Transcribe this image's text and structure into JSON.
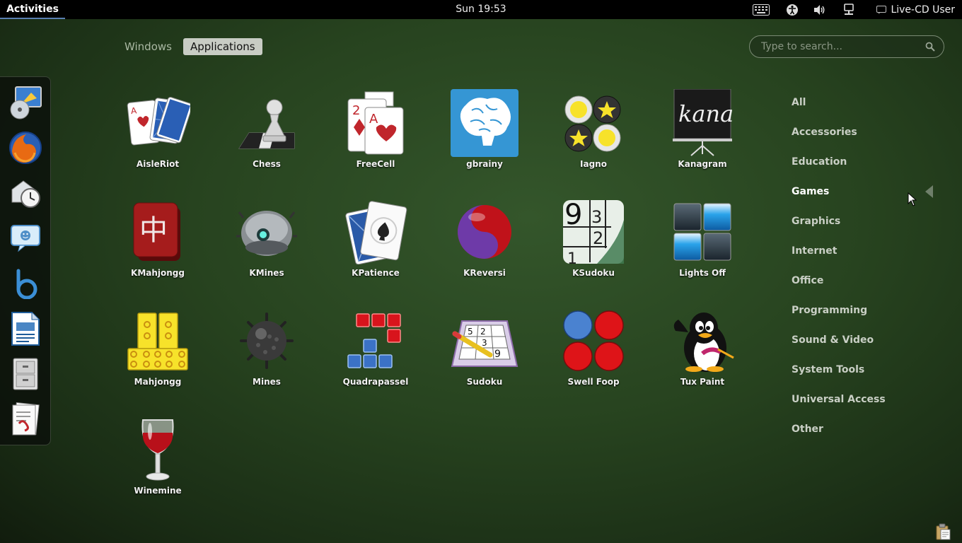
{
  "topbar": {
    "activities_label": "Activities",
    "clock": "Sun 19:53",
    "user_name": "Live-CD User",
    "tray_icons": [
      "keyboard-icon",
      "accessibility-icon",
      "volume-icon",
      "network-icon",
      "user-icon"
    ]
  },
  "view_selector": {
    "windows_label": "Windows",
    "applications_label": "Applications",
    "active": "Applications"
  },
  "search": {
    "placeholder": "Type to search..."
  },
  "dash": {
    "items": [
      "disc-burner-icon",
      "firefox-icon",
      "mail-clock-icon",
      "chat-icon",
      "banshee-icon",
      "writer-icon",
      "file-cabinet-icon",
      "document-viewer-icon"
    ]
  },
  "apps": [
    {
      "label": "AisleRiot",
      "icon": "cards-icon"
    },
    {
      "label": "Chess",
      "icon": "chess-icon"
    },
    {
      "label": "FreeCell",
      "icon": "freecell-icon"
    },
    {
      "label": "gbrainy",
      "icon": "brain-icon"
    },
    {
      "label": "Iagno",
      "icon": "iagno-icon"
    },
    {
      "label": "Kanagram",
      "icon": "kanagram-icon"
    },
    {
      "label": "KMahjongg",
      "icon": "mahjong-tile-icon"
    },
    {
      "label": "KMines",
      "icon": "kmines-icon"
    },
    {
      "label": "KPatience",
      "icon": "kpatience-icon"
    },
    {
      "label": "KReversi",
      "icon": "yin-yang-icon"
    },
    {
      "label": "KSudoku",
      "icon": "ksudoku-icon"
    },
    {
      "label": "Lights Off",
      "icon": "lights-off-icon"
    },
    {
      "label": "Mahjongg",
      "icon": "mahjongg-icon"
    },
    {
      "label": "Mines",
      "icon": "mine-icon"
    },
    {
      "label": "Quadrapassel",
      "icon": "tetris-icon"
    },
    {
      "label": "Sudoku",
      "icon": "sudoku-icon"
    },
    {
      "label": "Swell Foop",
      "icon": "swell-foop-icon"
    },
    {
      "label": "Tux Paint",
      "icon": "tux-icon"
    },
    {
      "label": "Winemine",
      "icon": "wine-glass-icon"
    }
  ],
  "icon_text": {
    "kana": "kana",
    "mahjong_char": "中",
    "freecell_2": "2",
    "freecell_a": "A",
    "aisleriot_a": "A",
    "sudoku_9": "9",
    "sudoku_3": "3",
    "sudoku_2": "2",
    "sudoku_1": "1",
    "sudoku_g1": "5",
    "sudoku_g2": "2",
    "sudoku_g3": "3",
    "sudoku_g4": "9"
  },
  "categories": {
    "items": [
      "All",
      "Accessories",
      "Education",
      "Games",
      "Graphics",
      "Internet",
      "Office",
      "Programming",
      "Sound & Video",
      "System Tools",
      "Universal Access",
      "Other"
    ],
    "active": "Games"
  },
  "colors": {
    "accent": "#5a7fb2",
    "background": "#27431f",
    "active_tab": "#c8ccc4"
  }
}
